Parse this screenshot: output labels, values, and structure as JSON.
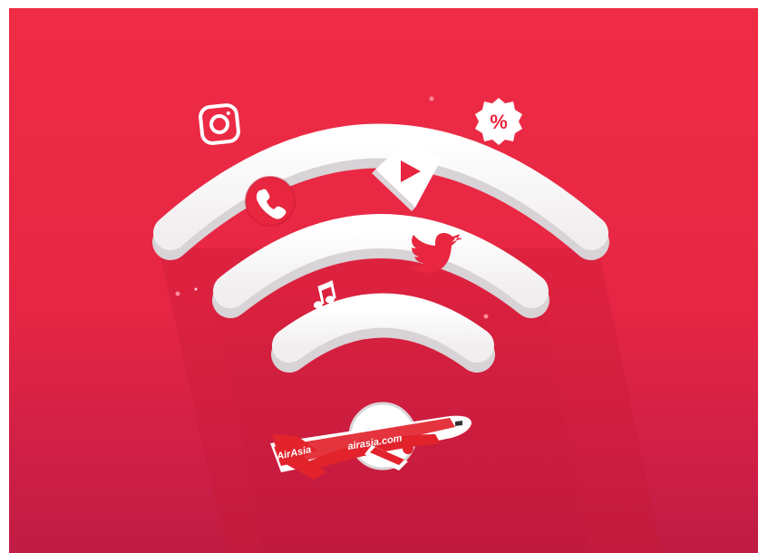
{
  "illustration": {
    "colors": {
      "background_top": "#ef2c45",
      "background_bottom": "#c01c44",
      "arc": "#ffffff",
      "arc_shadow": "#d81f3d",
      "badge": "#e8263f",
      "plane_red": "#e2232c"
    },
    "icons": [
      "instagram-icon",
      "percent-badge-icon",
      "phone-icon",
      "play-icon",
      "twitter-icon",
      "music-note-icon",
      "airplane-icon"
    ],
    "plane_livery": {
      "tail_text": "AirAsia",
      "body_text": "airasia.com"
    }
  }
}
